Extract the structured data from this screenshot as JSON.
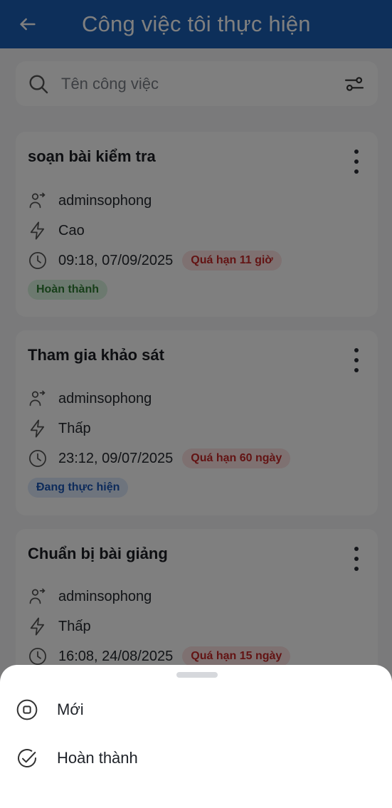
{
  "appbar": {
    "title": "Công việc tôi thực hiện",
    "back_icon": "arrow-left-icon"
  },
  "search": {
    "placeholder": "Tên công việc",
    "search_icon": "search-icon",
    "filter_icon": "filter-icon"
  },
  "tasks": [
    {
      "title": "soạn bài kiểm tra",
      "assignee": "adminsophong",
      "priority": "Cao",
      "deadline": "09:18, 07/09/2025",
      "overdue": "Quá hạn 11 giờ",
      "status": "Hoàn thành",
      "status_color": "#2e7d32"
    },
    {
      "title": "Tham gia khảo sát",
      "assignee": "adminsophong",
      "priority": "Thấp",
      "deadline": "23:12, 09/07/2025",
      "overdue": "Quá hạn 60 ngày",
      "status": "Đang thực hiện",
      "status_color": "#1a56b6"
    },
    {
      "title": "Chuẩn bị bài giảng",
      "assignee": "adminsophong",
      "priority": "Thấp",
      "deadline": "16:08, 24/08/2025",
      "overdue": "Quá hạn 15 ngày",
      "status": "",
      "status_color": ""
    }
  ],
  "sheet": {
    "options": [
      {
        "label": "Mới",
        "icon": "stop-circle-icon"
      },
      {
        "label": "Hoàn thành",
        "icon": "check-circle-icon"
      }
    ]
  },
  "colors": {
    "appbar": "#1a5fb4",
    "overdue_bg": "#fde2e2",
    "overdue_text": "#c62828"
  }
}
